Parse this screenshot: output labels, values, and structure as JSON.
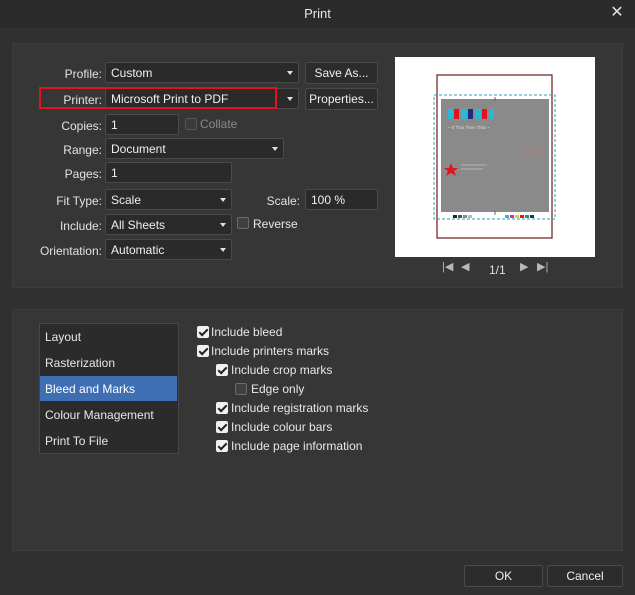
{
  "window": {
    "title": "Print"
  },
  "printer_settings": {
    "profile": {
      "label": "Profile:",
      "value": "Custom"
    },
    "save_as_label": "Save As...",
    "printer": {
      "label": "Printer:",
      "value": "Microsoft Print to PDF"
    },
    "properties_label": "Properties...",
    "copies": {
      "label": "Copies:",
      "value": "1"
    },
    "collate_label": "Collate",
    "range": {
      "label": "Range:",
      "value": "Document"
    },
    "pages": {
      "label": "Pages:",
      "value": "1"
    },
    "fit_type": {
      "label": "Fit Type:",
      "value": "Scale"
    },
    "scale": {
      "label": "Scale:",
      "value": "100 %"
    },
    "include": {
      "label": "Include:",
      "value": "All Sheets"
    },
    "reverse_label": "Reverse",
    "orientation": {
      "label": "Orientation:",
      "value": "Automatic"
    }
  },
  "preview": {
    "page_indicator": "1/1",
    "thumb_caption": "~ If This Then That ~"
  },
  "categories": {
    "items": [
      {
        "label": "Layout",
        "selected": false
      },
      {
        "label": "Rasterization",
        "selected": false
      },
      {
        "label": "Bleed and Marks",
        "selected": true
      },
      {
        "label": "Colour Management",
        "selected": false
      },
      {
        "label": "Print To File",
        "selected": false
      }
    ]
  },
  "bleed_and_marks": {
    "include_bleed": {
      "label": "Include bleed",
      "checked": true
    },
    "include_printers_marks": {
      "label": "Include printers marks",
      "checked": true
    },
    "include_crop_marks": {
      "label": "Include crop marks",
      "checked": true
    },
    "edge_only": {
      "label": "Edge only",
      "checked": false
    },
    "include_registration_marks": {
      "label": "Include registration marks",
      "checked": true
    },
    "include_colour_bars": {
      "label": "Include colour bars",
      "checked": true
    },
    "include_page_information": {
      "label": "Include page information",
      "checked": true
    }
  },
  "footer": {
    "ok_label": "OK",
    "cancel_label": "Cancel"
  },
  "colors": {
    "highlight": "#e0141c",
    "selection": "#3e6fb5"
  }
}
